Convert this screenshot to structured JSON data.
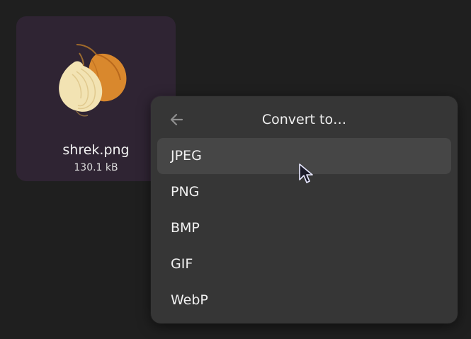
{
  "file": {
    "name": "shrek.png",
    "size": "130.1 kB",
    "thumbnail_icon": "onion-image-icon"
  },
  "popover": {
    "title": "Convert to…",
    "back_icon": "arrow-left-icon",
    "items": [
      {
        "label": "JPEG"
      },
      {
        "label": "PNG"
      },
      {
        "label": "BMP"
      },
      {
        "label": "GIF"
      },
      {
        "label": "WebP"
      }
    ]
  },
  "colors": {
    "background": "#1f1f1f",
    "card": "#2f2433",
    "popover": "#363636",
    "hover": "#464646"
  }
}
